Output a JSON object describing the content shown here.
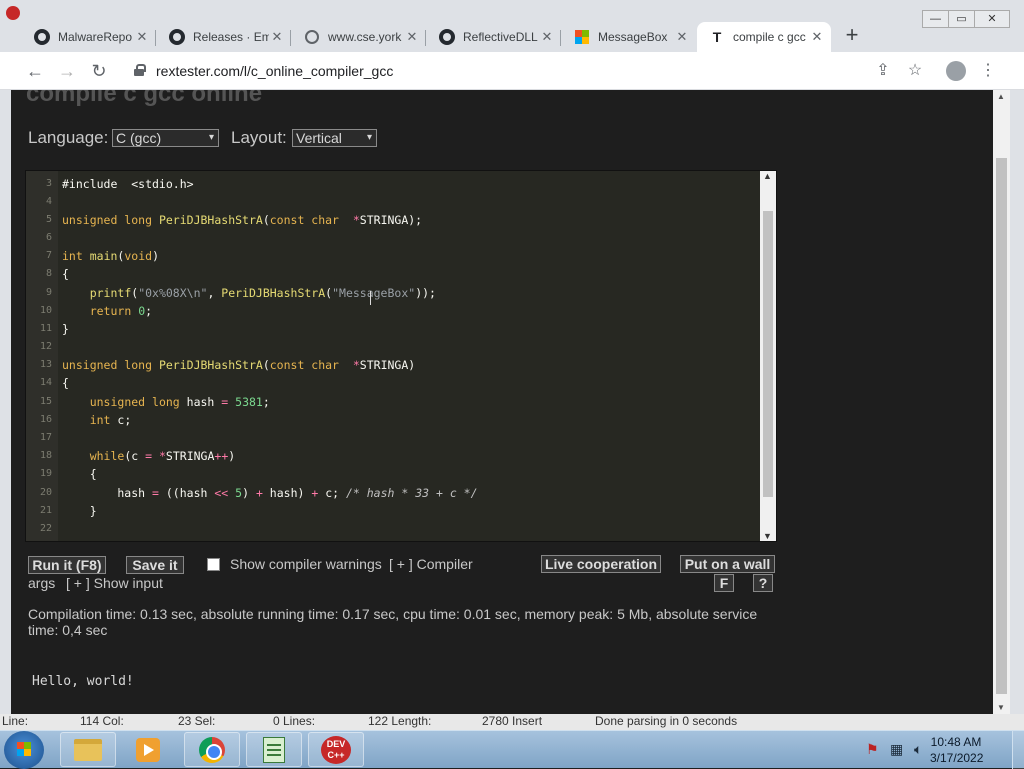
{
  "tabs": [
    {
      "title": "MalwareRepo",
      "icon": "github-icon",
      "close": "✕"
    },
    {
      "title": "Releases · Em",
      "icon": "github-icon",
      "close": "✕"
    },
    {
      "title": "www.cse.york",
      "icon": "globe-icon",
      "close": "✕"
    },
    {
      "title": "ReflectiveDLL",
      "icon": "github-icon",
      "close": "✕"
    },
    {
      "title": "MessageBox",
      "icon": "microsoft-icon",
      "close": "✕"
    },
    {
      "title": "compile c gcc",
      "icon": "rextester-icon",
      "favicon_letter": "T",
      "close": "✕",
      "active": true
    }
  ],
  "browser": {
    "url": "rextester.com/l/c_online_compiler_gcc",
    "new_tab": "+",
    "back": "←",
    "forward": "→",
    "reload": "↻",
    "share": "⇪",
    "star": "☆",
    "menu": "⋮",
    "win_min": "—",
    "win_max": "▭",
    "win_close": "✕"
  },
  "page": {
    "title": "compile c gcc online",
    "language_label": "Language:",
    "language_value": "C (gcc)",
    "layout_label": "Layout:",
    "layout_value": "Vertical",
    "caret": "▾"
  },
  "editor": {
    "line_numbers": [
      "3",
      "4",
      "5",
      "6",
      "7",
      "8",
      "9",
      "10",
      "11",
      "12",
      "13",
      "14",
      "15",
      "16",
      "17",
      "18",
      "19",
      "20",
      "21",
      "22"
    ],
    "scroll_up": "▲",
    "scroll_down": "▼"
  },
  "actions": {
    "run": "Run it (F8)",
    "save": "Save it",
    "show_warnings": "Show compiler warnings",
    "compiler_args": "[ + ] Compiler",
    "args": "args",
    "show_input": "[ + ] Show input",
    "live_cooperation": "Live cooperation",
    "put_on_wall": "Put on a wall",
    "fullscreen": "F",
    "help": "?"
  },
  "stats": "Compilation time: 0.13 sec, absolute running time: 0.17 sec, cpu time: 0.01 sec, memory peak: 5 Mb, absolute service time: 0,4 sec",
  "output": "Hello, world!",
  "statusbar": {
    "line": "Line:",
    "line_val": "114 Col:",
    "col_val": "23 Sel:",
    "sel_val": "0 Lines:",
    "lines_val": "122 Length:",
    "length_val": "2780 Insert",
    "parse": "Done parsing in 0 seconds"
  },
  "taskbar": {
    "devcpp_label": "DEV C++",
    "time": "10:48 AM",
    "date": "3/17/2022",
    "tray_icons": [
      "flag-icon",
      "network-icon",
      "volume-icon"
    ]
  }
}
